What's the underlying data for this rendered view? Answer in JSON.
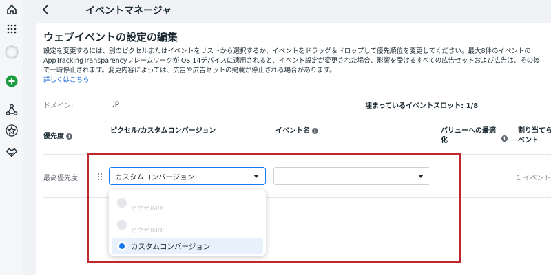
{
  "nav": {
    "icons": [
      "home-icon",
      "grid-icon",
      "account-avatar-icon",
      "add-icon",
      "network-icon",
      "star-icon",
      "handshake-icon"
    ]
  },
  "topbar": {
    "title": "イベントマネージャ"
  },
  "page": {
    "heading": "ウェブイベントの設定の編集",
    "description_lines": [
      "設定を変更するには、別のピクセルまたはイベントをリストから選択するか、イベントをドラッグ＆ドロップして優先順位を変更してください。最大8件のイベントの",
      "AppTrackingTransparencyフレームワークがiOS 14デバイスに適用されると、イベント設定が変更された場合、影響を受けるすべての広告セットおよび広告は、その後",
      "で一時停止されます。変更内容によっては、広告や広告セットの掲載が停止される場合があります。"
    ],
    "learn_more": "詳しくはこちら",
    "domain_label": "ドメイン:",
    "domain_value": "jp",
    "slots_text": "埋まっているイベントスロット: 1/8"
  },
  "table": {
    "headers": {
      "priority": "優先度",
      "pixel": "ピクセル/カスタムコンバージョン",
      "event_name": "イベント名",
      "value_opt_line1": "バリューへの最適",
      "value_opt_line2": "化",
      "assign_line1": "割り当てら",
      "assign_line2": "ベント"
    },
    "row": {
      "priority": "最高優先度",
      "pixel_select": "カスタムコンバージョン",
      "event_select": "",
      "events_count": "1 イベント"
    }
  },
  "dropdown": {
    "options": [
      {
        "label": "ピクセルID:",
        "selected": false
      },
      {
        "label": "ピクセルID:",
        "selected": false
      },
      {
        "label": "カスタムコンバージョン",
        "selected": true
      }
    ]
  },
  "colors": {
    "highlight": "#c0272d",
    "accent": "#1877f2",
    "link": "#216fdb"
  }
}
